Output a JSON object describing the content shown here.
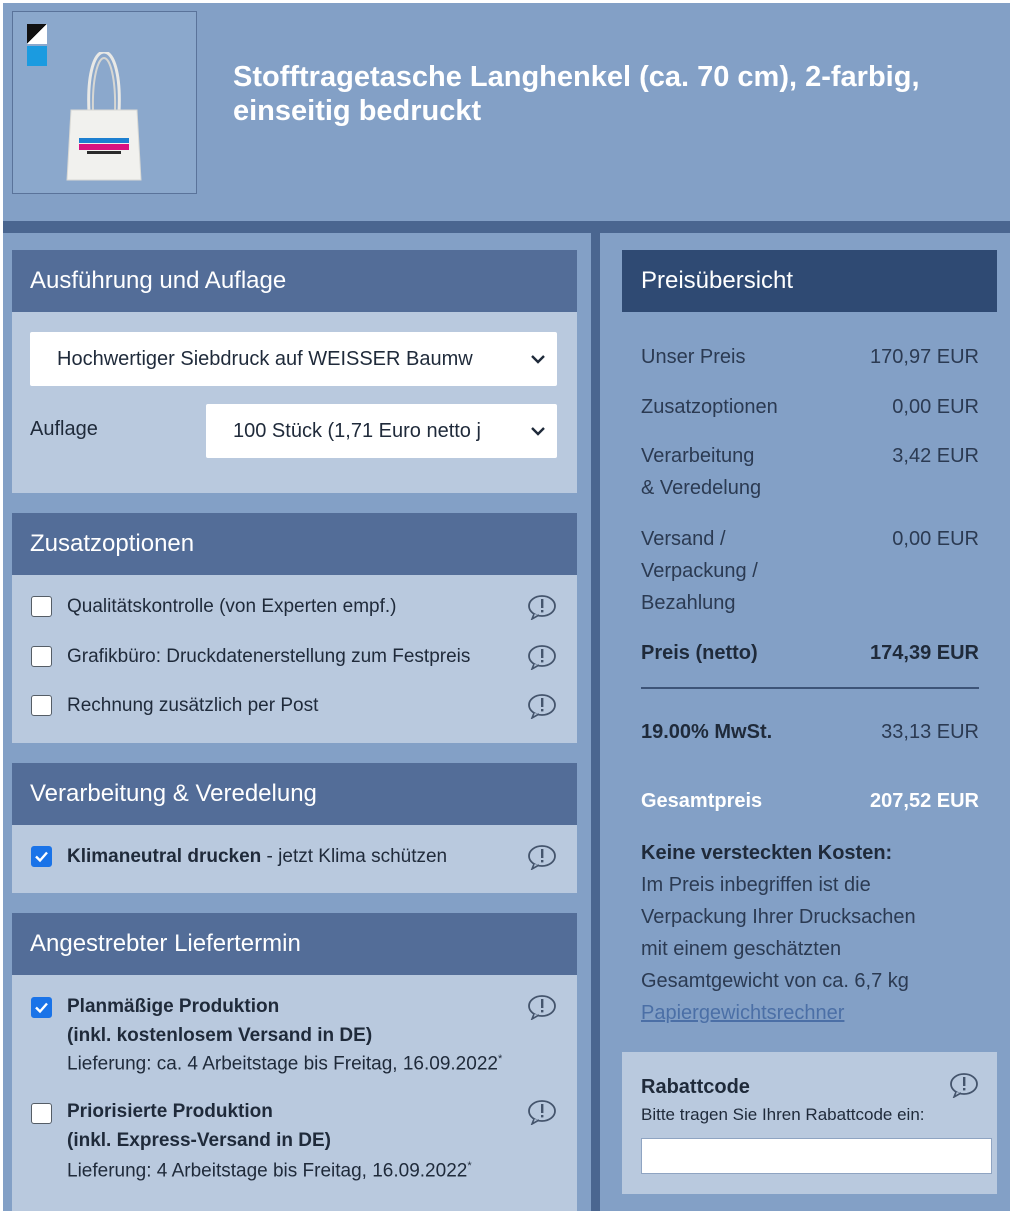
{
  "product": {
    "title_line1": "Stofftragetasche Langhenkel (ca. 70 cm), 2-farbig,",
    "title_line2": "einseitig bedruckt"
  },
  "ausfuehrung": {
    "heading": "Ausführung und Auflage",
    "variant_select": "Hochwertiger Siebdruck auf WEISSER Baumw",
    "auflage_label": "Auflage",
    "auflage_select": "100 Stück (1,71 Euro netto j"
  },
  "zusatzoptionen": {
    "heading": "Zusatzoptionen",
    "items": [
      {
        "label": "Qualitätskontrolle (von Experten empf.)",
        "checked": false
      },
      {
        "label": "Grafikbüro: Druckdatenerstellung zum Festpreis",
        "checked": false
      },
      {
        "label": "Rechnung zusätzlich per Post",
        "checked": false
      }
    ]
  },
  "verarbeitung": {
    "heading": "Verarbeitung & Veredelung",
    "item_bold": "Klimaneutral drucken",
    "item_rest": " - jetzt Klima schützen",
    "checked": true
  },
  "liefertermin": {
    "heading": "Angestrebter Liefertermin",
    "options": [
      {
        "title1": "Planmäßige Produktion",
        "title2": "(inkl. kostenlosem Versand in DE)",
        "delivery": "Lieferung: ca. 4 Arbeitstage bis Freitag, 16.09.2022",
        "mark": "*",
        "checked": true
      },
      {
        "title1": "Priorisierte Produktion",
        "title2": "(inkl. Express-Versand in DE)",
        "delivery": "Lieferung: 4 Arbeitstage bis Freitag, 16.09.2022",
        "mark": "*",
        "checked": false
      }
    ]
  },
  "preis": {
    "heading": "Preisübersicht",
    "unser_preis_label": "Unser Preis",
    "unser_preis_value": "170,97 EUR",
    "zusatz_label": "Zusatzoptionen",
    "zusatz_value": "0,00 EUR",
    "verarbeitung_label1": "Verarbeitung",
    "verarbeitung_label2": "& Veredelung",
    "verarbeitung_value": "3,42 EUR",
    "versand_label1": "Versand /",
    "versand_label2": "Verpackung /",
    "versand_label3": "Bezahlung",
    "versand_value": "0,00 EUR",
    "netto_label": "Preis (netto)",
    "netto_value": "174,39 EUR",
    "mwst_label": "19.00% MwSt.",
    "mwst_value": "33,13 EUR",
    "gesamt_label": "Gesamtpreis",
    "gesamt_value": "207,52 EUR",
    "note_bold": "Keine versteckten Kosten:",
    "note_line1": "Im Preis inbegriffen ist die",
    "note_line2": "Verpackung Ihrer Drucksachen",
    "note_line3": "mit einem geschätzten",
    "note_line4": "Gesamtgewicht von ca. 6,7 kg",
    "link": "Papiergewichtsrechner"
  },
  "rabatt": {
    "title": "Rabattcode",
    "subtitle": "Bitte tragen Sie Ihren Rabattcode ein:",
    "value": ""
  }
}
